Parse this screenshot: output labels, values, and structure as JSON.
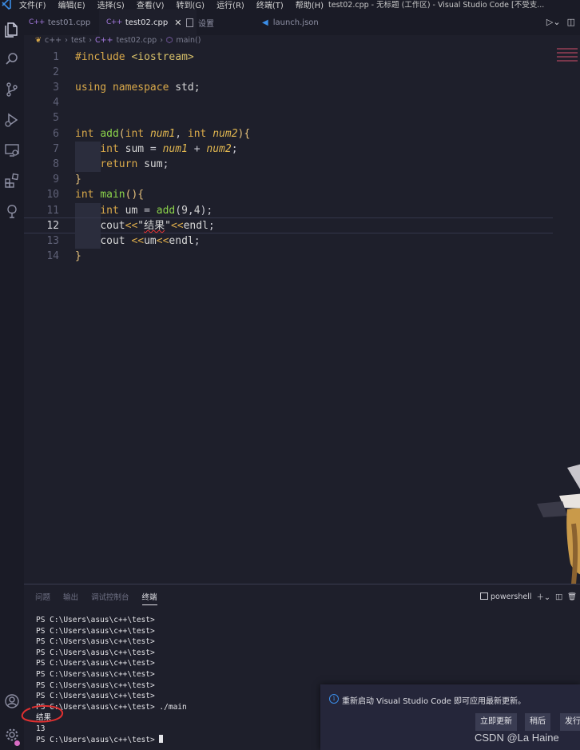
{
  "titlebar": {
    "menu": [
      "文件(F)",
      "编辑(E)",
      "选择(S)",
      "查看(V)",
      "转到(G)",
      "运行(R)",
      "终端(T)",
      "帮助(H)"
    ],
    "window_title": "test02.cpp - 无标题 (工作区) - Visual Studio Code [不受支..."
  },
  "tabs": [
    {
      "label": "test01.cpp",
      "icon": "cpp-file-icon",
      "active": false
    },
    {
      "label": "test02.cpp",
      "icon": "cpp-file-icon",
      "active": true
    },
    {
      "label": "设置",
      "icon": "settings-file-icon",
      "active": false
    },
    {
      "label": "launch.json",
      "icon": "vscode-json-icon",
      "active": false
    }
  ],
  "icons": {
    "cpp_glyph": "C++",
    "close": "✕"
  },
  "breadcrumb": [
    "c++",
    "test",
    "test02.cpp",
    "main()"
  ],
  "editor": {
    "current_line": 12,
    "line_numbers": [
      "1",
      "2",
      "3",
      "4",
      "5",
      "6",
      "7",
      "8",
      "9",
      "10",
      "11",
      "12",
      "13",
      "14"
    ]
  },
  "panel": {
    "tabs": [
      "问题",
      "输出",
      "调试控制台",
      "终端"
    ],
    "active_tab": "终端",
    "shell": "powershell",
    "terminal_lines": [
      "PS C:\\Users\\asus\\c++\\test>",
      "PS C:\\Users\\asus\\c++\\test>",
      "PS C:\\Users\\asus\\c++\\test>",
      "PS C:\\Users\\asus\\c++\\test>",
      "PS C:\\Users\\asus\\c++\\test>",
      "PS C:\\Users\\asus\\c++\\test>",
      "PS C:\\Users\\asus\\c++\\test>",
      "PS C:\\Users\\asus\\c++\\test>",
      "PS C:\\Users\\asus\\c++\\test> ./main",
      "结果",
      "13",
      "PS C:\\Users\\asus\\c++\\test> "
    ]
  },
  "notification": {
    "message": "重新启动 Visual Studio Code 即可应用最新更新。",
    "buttons": [
      "立即更新",
      "稍后",
      "发行"
    ]
  },
  "watermark": "CSDN @La Haine",
  "colors": {
    "accent": "#3b8ee8",
    "keyword": "#d9a94a",
    "function": "#8bd24a",
    "error": "#e33333"
  }
}
